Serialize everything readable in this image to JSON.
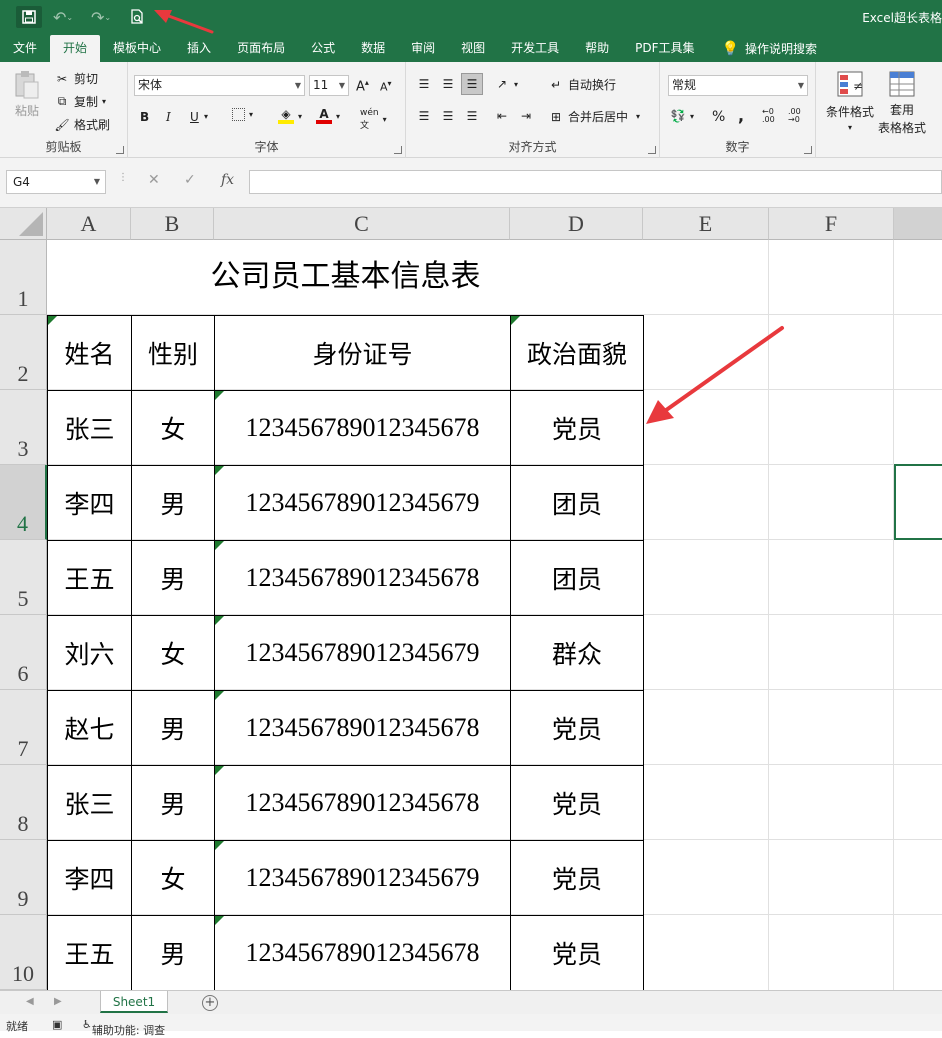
{
  "window": {
    "title": "Excel超长表格"
  },
  "colors": {
    "accent": "#217346",
    "arrow": "#e8393d"
  },
  "tabs": [
    "文件",
    "开始",
    "模板中心",
    "插入",
    "页面布局",
    "公式",
    "数据",
    "审阅",
    "视图",
    "开发工具",
    "帮助",
    "PDF工具集"
  ],
  "tell_me": "操作说明搜索",
  "ribbon": {
    "clipboard": {
      "paste": "粘贴",
      "cut": "剪切",
      "copy": "复制",
      "format_painter": "格式刷",
      "label": "剪贴板"
    },
    "font": {
      "name": "宋体",
      "size": "11",
      "bold": "B",
      "italic": "I",
      "underline": "U",
      "label": "字体"
    },
    "alignment": {
      "wrap": "自动换行",
      "merge": "合并后居中",
      "label": "对齐方式"
    },
    "number": {
      "format": "常规",
      "percent": "%",
      "comma": ",",
      "label": "数字"
    },
    "styles": {
      "conditional": "条件格式",
      "table_line1": "套用",
      "table_line2": "表格格式"
    }
  },
  "formula_bar": {
    "name_box": "G4",
    "fx": "fx"
  },
  "grid": {
    "columns": [
      "A",
      "B",
      "C",
      "D",
      "E",
      "F"
    ],
    "rows": [
      "1",
      "2",
      "3",
      "4",
      "5",
      "6",
      "7",
      "8",
      "9",
      "10"
    ],
    "title": "公司员工基本信息表",
    "headers": [
      "姓名",
      "性别",
      "身份证号",
      "政治面貌"
    ],
    "records": [
      [
        "张三",
        "女",
        "123456789012345678",
        "党员"
      ],
      [
        "李四",
        "男",
        "123456789012345679",
        "团员"
      ],
      [
        "王五",
        "男",
        "123456789012345678",
        "团员"
      ],
      [
        "刘六",
        "女",
        "123456789012345679",
        "群众"
      ],
      [
        "赵七",
        "男",
        "123456789012345678",
        "党员"
      ],
      [
        "张三",
        "男",
        "123456789012345678",
        "党员"
      ],
      [
        "李四",
        "女",
        "123456789012345679",
        "党员"
      ],
      [
        "王五",
        "男",
        "123456789012345678",
        "党员"
      ]
    ]
  },
  "sheets": [
    "Sheet1"
  ],
  "status": {
    "ready": "就绪",
    "accessibility": "辅助功能: 调查"
  }
}
